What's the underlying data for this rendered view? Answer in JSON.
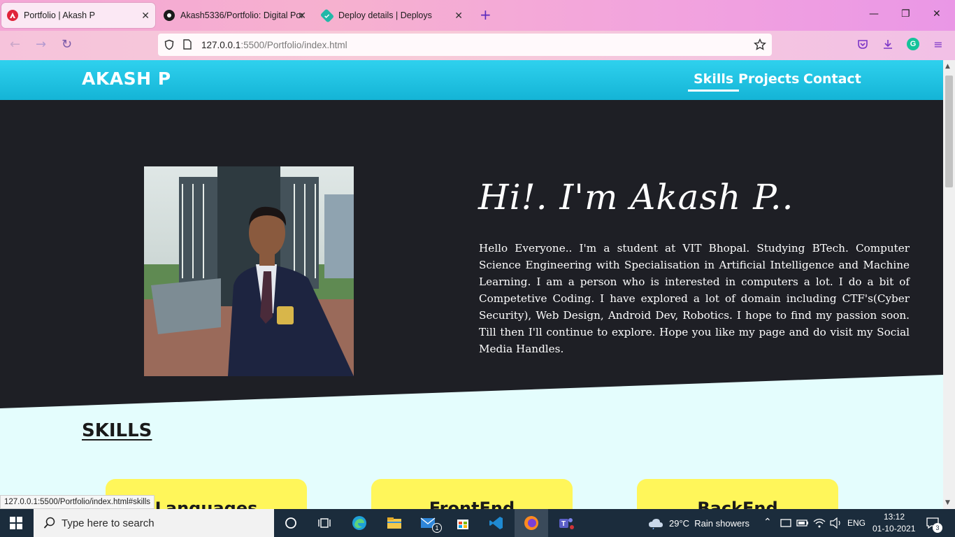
{
  "browser": {
    "tabs": [
      {
        "label": "Portfolio | Akash P",
        "icon": "vivaldi-style-red-icon",
        "active": true
      },
      {
        "label": "Akash5336/Portfolio: Digital Por",
        "icon": "github-icon",
        "active": false
      },
      {
        "label": "Deploy details | Deploys",
        "icon": "netlify-icon",
        "active": false
      }
    ],
    "new_tab": "+",
    "window_controls": {
      "minimize": "—",
      "restore": "❐",
      "close": "✕"
    },
    "url": {
      "host": "127.0.0.1",
      "path": ":5500/Portfolio/index.html"
    },
    "status_url": "127.0.0.1:5500/Portfolio/index.html#skills"
  },
  "site": {
    "brand": "AKASH P",
    "nav": [
      {
        "label": "Skills",
        "active": true
      },
      {
        "label": "Projects",
        "active": false
      },
      {
        "label": "Contact",
        "active": false
      }
    ],
    "hero": {
      "title": "Hi!. I'm Akash P..",
      "paragraph": "Hello Everyone.. I'm a student at VIT Bhopal. Studying BTech. Computer Science Engineering with Specialisation in Artificial Intelligence and Machine Learning. I am a person who is interested in computers a lot. I do a bit of Competetive Coding. I have explored a lot of domain including CTF's(Cyber Security), Web Design, Android Dev, Robotics. I hope to find my passion soon. Till then I'll continue to explore. Hope you like my page and do visit my Social Media Handles."
    },
    "skills": {
      "heading": "SKILLS",
      "cards": [
        "Languages",
        "FrontEnd",
        "BackEnd"
      ]
    }
  },
  "taskbar": {
    "search_placeholder": "Type here to search",
    "weather": "29°C  Rain showers",
    "language": "ENG",
    "time": "13:12",
    "date": "01-10-2021",
    "notifications": "3",
    "mail_badge": "1"
  },
  "colors": {
    "header": "#14b4d6",
    "hero_bg": "#1e1f25",
    "page_bg": "#e4fdfd",
    "skill_card": "#fff65a"
  }
}
